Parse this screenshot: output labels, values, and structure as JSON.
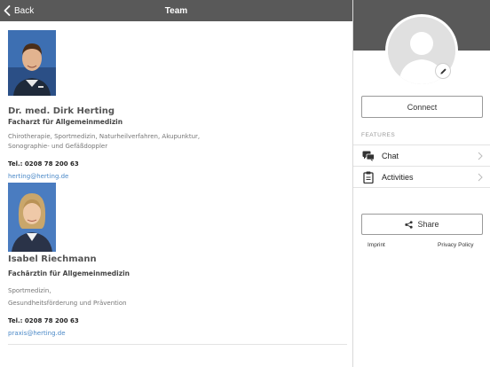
{
  "topbar": {
    "back_label": "Back",
    "title": "Team"
  },
  "members": [
    {
      "name": "Dr. med. Dirk Herting",
      "title": "Facharzt für Allgemeinmedizin",
      "desc_line1": "Chirotherapie, Sportmedizin, Naturheilverfahren, Akupunktur,",
      "desc_line2": "Sonographie- und Gefäßdoppler",
      "tel": "Tel.: 0208 78 200 63",
      "email": "herting@herting.de"
    },
    {
      "name": "Isabel Riechmann",
      "title": "Fachärztin für Allgemeinmedizin",
      "desc_line1": "Sportmedizin,",
      "desc_line2": "Gesundheitsförderung und Prävention",
      "tel": "Tel.: 0208 78 200 63",
      "email": "praxis@herting.de"
    }
  ],
  "sidebar": {
    "connect_label": "Connect",
    "features_label": "FEATURES",
    "features": [
      {
        "label": "Chat",
        "icon": "chat-icon"
      },
      {
        "label": "Activities",
        "icon": "clipboard-icon"
      }
    ],
    "share_label": "Share",
    "imprint_label": "Imprint",
    "privacy_label": "Privacy Policy"
  },
  "colors": {
    "header_bg": "#595959",
    "link": "#4a88c7",
    "photo_bg": "#3b6fb0"
  }
}
